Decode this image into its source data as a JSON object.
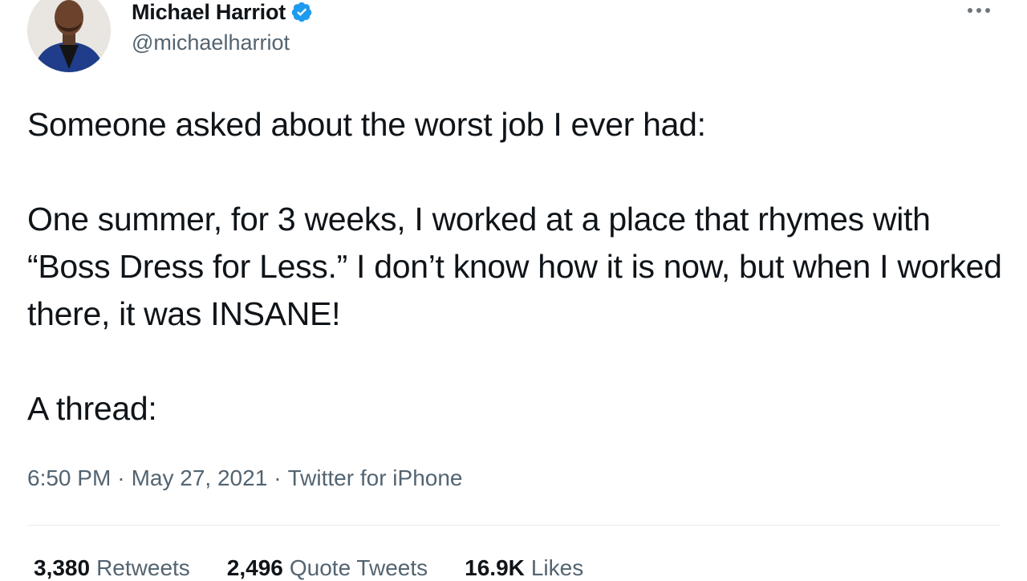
{
  "author": {
    "display_name": "Michael Harriot",
    "handle": "@michaelharriot",
    "verified": true
  },
  "tweet": {
    "paragraphs": [
      "Someone asked about the worst job I ever had:",
      "One summer, for 3 weeks, I worked at a place that rhymes with “Boss Dress for Less.” I don’t know how it is now, but when I worked there, it was INSANE!",
      "A thread:"
    ]
  },
  "meta": {
    "time": "6:50 PM",
    "separator": "·",
    "date": "May 27, 2021",
    "source": "Twitter for iPhone"
  },
  "stats": {
    "retweets_count": "3,380",
    "retweets_label": "Retweets",
    "quote_count": "2,496",
    "quote_label": "Quote Tweets",
    "likes_count": "16.9K",
    "likes_label": "Likes"
  },
  "colors": {
    "verified_badge": "#1d9bf0",
    "text_primary": "#0f1419",
    "text_secondary": "#536471"
  },
  "icons": {
    "more": "more-horizontal-icon",
    "verified": "verified-badge-icon"
  }
}
